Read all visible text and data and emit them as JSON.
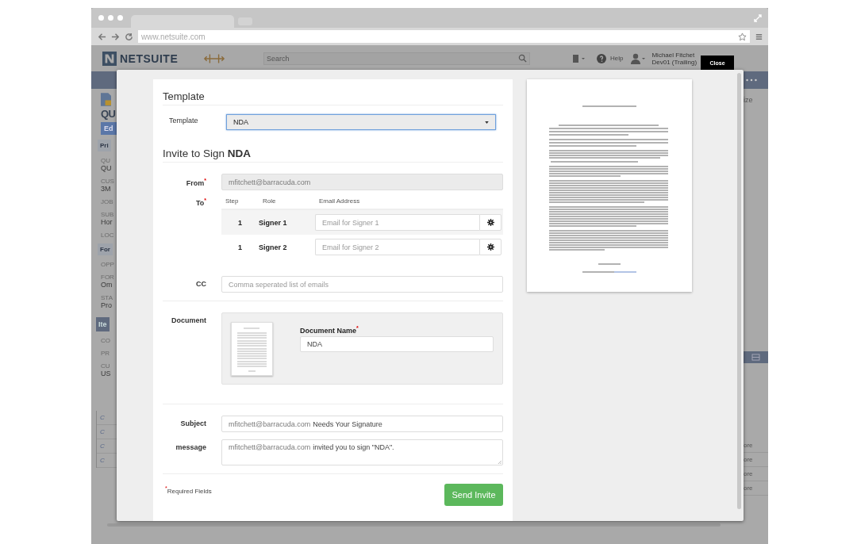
{
  "browser": {
    "url": "www.netsuite.com"
  },
  "header": {
    "logo": "NETSUITE",
    "search_placeholder": "Search",
    "help": "Help",
    "user_name": "Michael Fitchet",
    "user_role": "Dev01 (Trailing)"
  },
  "background_left": [
    {
      "kind": "title",
      "text": "QU"
    },
    {
      "kind": "button",
      "text": "Ed"
    },
    {
      "kind": "section",
      "text": "Pri"
    },
    {
      "kind": "label",
      "text": "QU"
    },
    {
      "kind": "value",
      "text": "QU"
    },
    {
      "kind": "label",
      "text": "CUS"
    },
    {
      "kind": "value",
      "text": "3M"
    },
    {
      "kind": "label",
      "text": "JOB"
    },
    {
      "kind": "label",
      "text": "SUB"
    },
    {
      "kind": "value",
      "text": "Hor"
    },
    {
      "kind": "label",
      "text": "LOC"
    },
    {
      "kind": "section",
      "text": "For"
    },
    {
      "kind": "label",
      "text": "OPP"
    },
    {
      "kind": "label",
      "text": "FOR"
    },
    {
      "kind": "value",
      "text": "Om"
    },
    {
      "kind": "label",
      "text": "STA"
    },
    {
      "kind": "value",
      "text": "Pro"
    },
    {
      "kind": "tab",
      "text": "Ite"
    },
    {
      "kind": "label",
      "text": "CO"
    },
    {
      "kind": "label",
      "text": "PR"
    },
    {
      "kind": "label",
      "text": "CU"
    },
    {
      "kind": "value",
      "text": "US"
    }
  ],
  "background_table_left": [
    "C",
    "C",
    "C",
    "C"
  ],
  "background_right": {
    "text": "ize",
    "table": [
      "ore",
      "ore",
      "ore",
      "ore"
    ]
  },
  "modal": {
    "close": "Close",
    "template_section": {
      "title": "Template",
      "label": "Template",
      "value": "NDA"
    },
    "invite": {
      "title": "Invite to Sign **NDA**",
      "from": {
        "label": "From$^{*}$",
        "value": "mfitchett@barracuda.com"
      },
      "to": {
        "label": "To$^{*}$",
        "columns": [
          "Step",
          "Role",
          "Email Address"
        ],
        "signers": [
          {
            "step": "1",
            "role": "Signer 1",
            "placeholder": "Email for Signer 1"
          },
          {
            "step": "1",
            "role": "Signer 2",
            "placeholder": "Email for Signer 2"
          }
        ]
      },
      "cc": {
        "label": "CC",
        "placeholder": "Comma seperated list of emails"
      },
      "document": {
        "label": "Document",
        "name_label": "Document Name$^{*}$",
        "name_value": "NDA"
      },
      "subject": {
        "label": "Subject",
        "sender": "mfitchett@barracuda.com",
        "text": "Needs Your Signature"
      },
      "message": {
        "label": "message",
        "sender": "mfitchett@barracuda.com",
        "text": "invited you to sign \"NDA\"."
      }
    },
    "required_note": "$^{*}$Required Fields",
    "send_button": "Send Invite"
  }
}
